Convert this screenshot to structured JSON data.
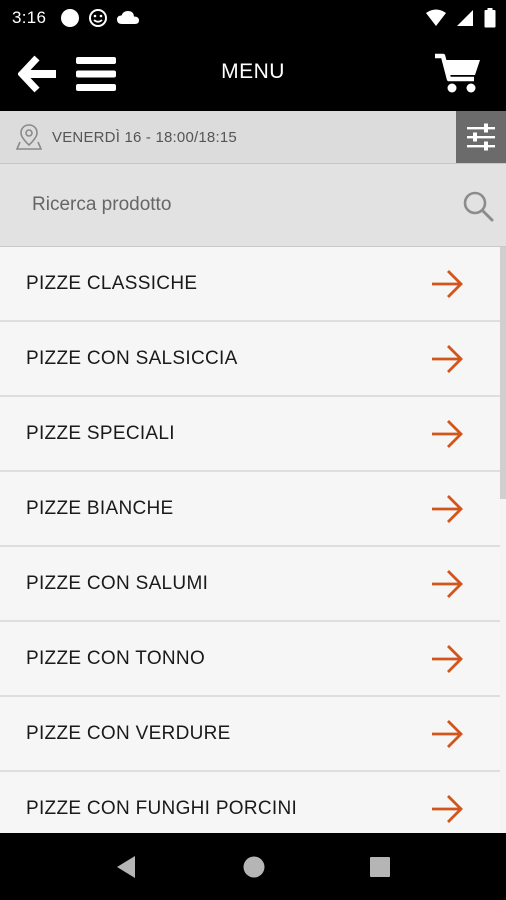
{
  "status_bar": {
    "time": "3:16",
    "left_icons": [
      "circle-icon",
      "smiley-icon",
      "cloud-icon"
    ],
    "right_icons": [
      "wifi-icon",
      "cellular-icon",
      "battery-icon"
    ]
  },
  "header": {
    "title": "MENU",
    "back_icon": "back-arrow-icon",
    "menu_icon": "hamburger-icon",
    "cart_icon": "cart-icon"
  },
  "delivery": {
    "slot_text": "VENERDÌ 16 - 18:00/18:15",
    "pin_icon": "location-pin-icon",
    "filter_icon": "sliders-icon"
  },
  "search": {
    "placeholder": "Ricerca prodotto",
    "value": ""
  },
  "categories": [
    {
      "label": "PIZZE CLASSICHE"
    },
    {
      "label": "PIZZE CON SALSICCIA"
    },
    {
      "label": "PIZZE SPECIALI"
    },
    {
      "label": "PIZZE BIANCHE"
    },
    {
      "label": "PIZZE CON SALUMI"
    },
    {
      "label": "PIZZE CON TONNO"
    },
    {
      "label": "PIZZE CON VERDURE"
    },
    {
      "label": "PIZZE CON FUNGHI PORCINI"
    }
  ],
  "colors": {
    "accent": "#d2561c",
    "header_bg": "#000000",
    "delivery_bg": "#dcdcdc",
    "filter_bg": "#6b6b6b"
  },
  "nav_bar": {
    "icons": [
      "nav-back-icon",
      "nav-home-icon",
      "nav-recents-icon"
    ]
  }
}
